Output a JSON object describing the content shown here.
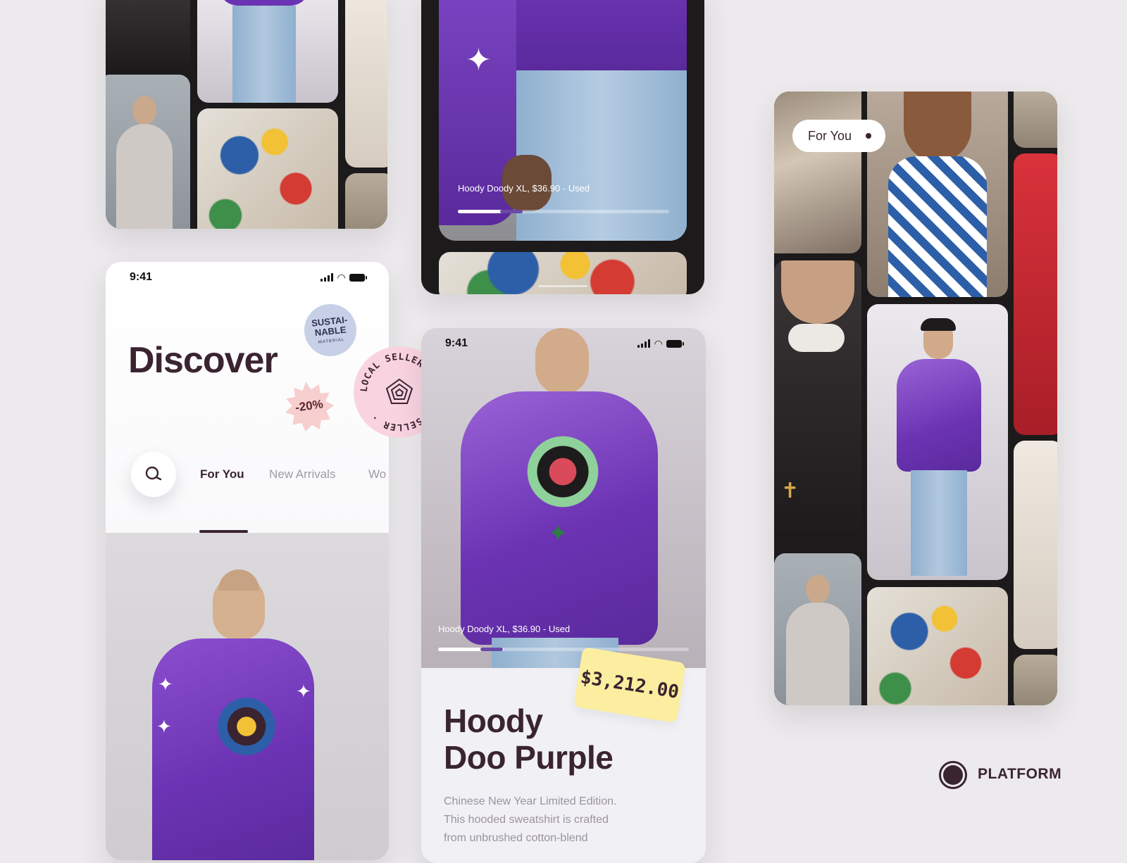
{
  "discover_screen": {
    "time": "9:41",
    "title": "Discover",
    "tabs": [
      "For You",
      "New Arrivals",
      "Wo"
    ],
    "active_tab": "For You",
    "stickers": {
      "sustainable": [
        "SUSTAI-",
        "NABLE",
        "MATERIAL"
      ],
      "discount": "-20%",
      "local_seller": "LOCAL SELLER"
    }
  },
  "product_preview": {
    "caption": "Hoody Doody XL, $36.90 - Used",
    "progress": 0.3
  },
  "product_screen": {
    "time": "9:41",
    "caption": "Hoody Doody XL, $36.90 - Used",
    "progress": 0.3,
    "price": "$3,212.00",
    "title_line1": "Hoody",
    "title_line2": "Doo Purple",
    "description": [
      "Chinese New Year Limited Edition.",
      "This hooded sweatshirt is crafted",
      "from unbrushed cotton-blend"
    ]
  },
  "feed_screen": {
    "pill_label": "For You"
  },
  "brand": {
    "name": "PLATFORM"
  },
  "colors": {
    "background": "#eceaec",
    "ink": "#3a2430",
    "accent_purple": "#6b33b3",
    "price_tag": "#fbeea0",
    "sticker_pink": "#f9d3e0",
    "sticker_blue": "#c7d0e6",
    "sticker_peach": "#f7cfcf"
  }
}
